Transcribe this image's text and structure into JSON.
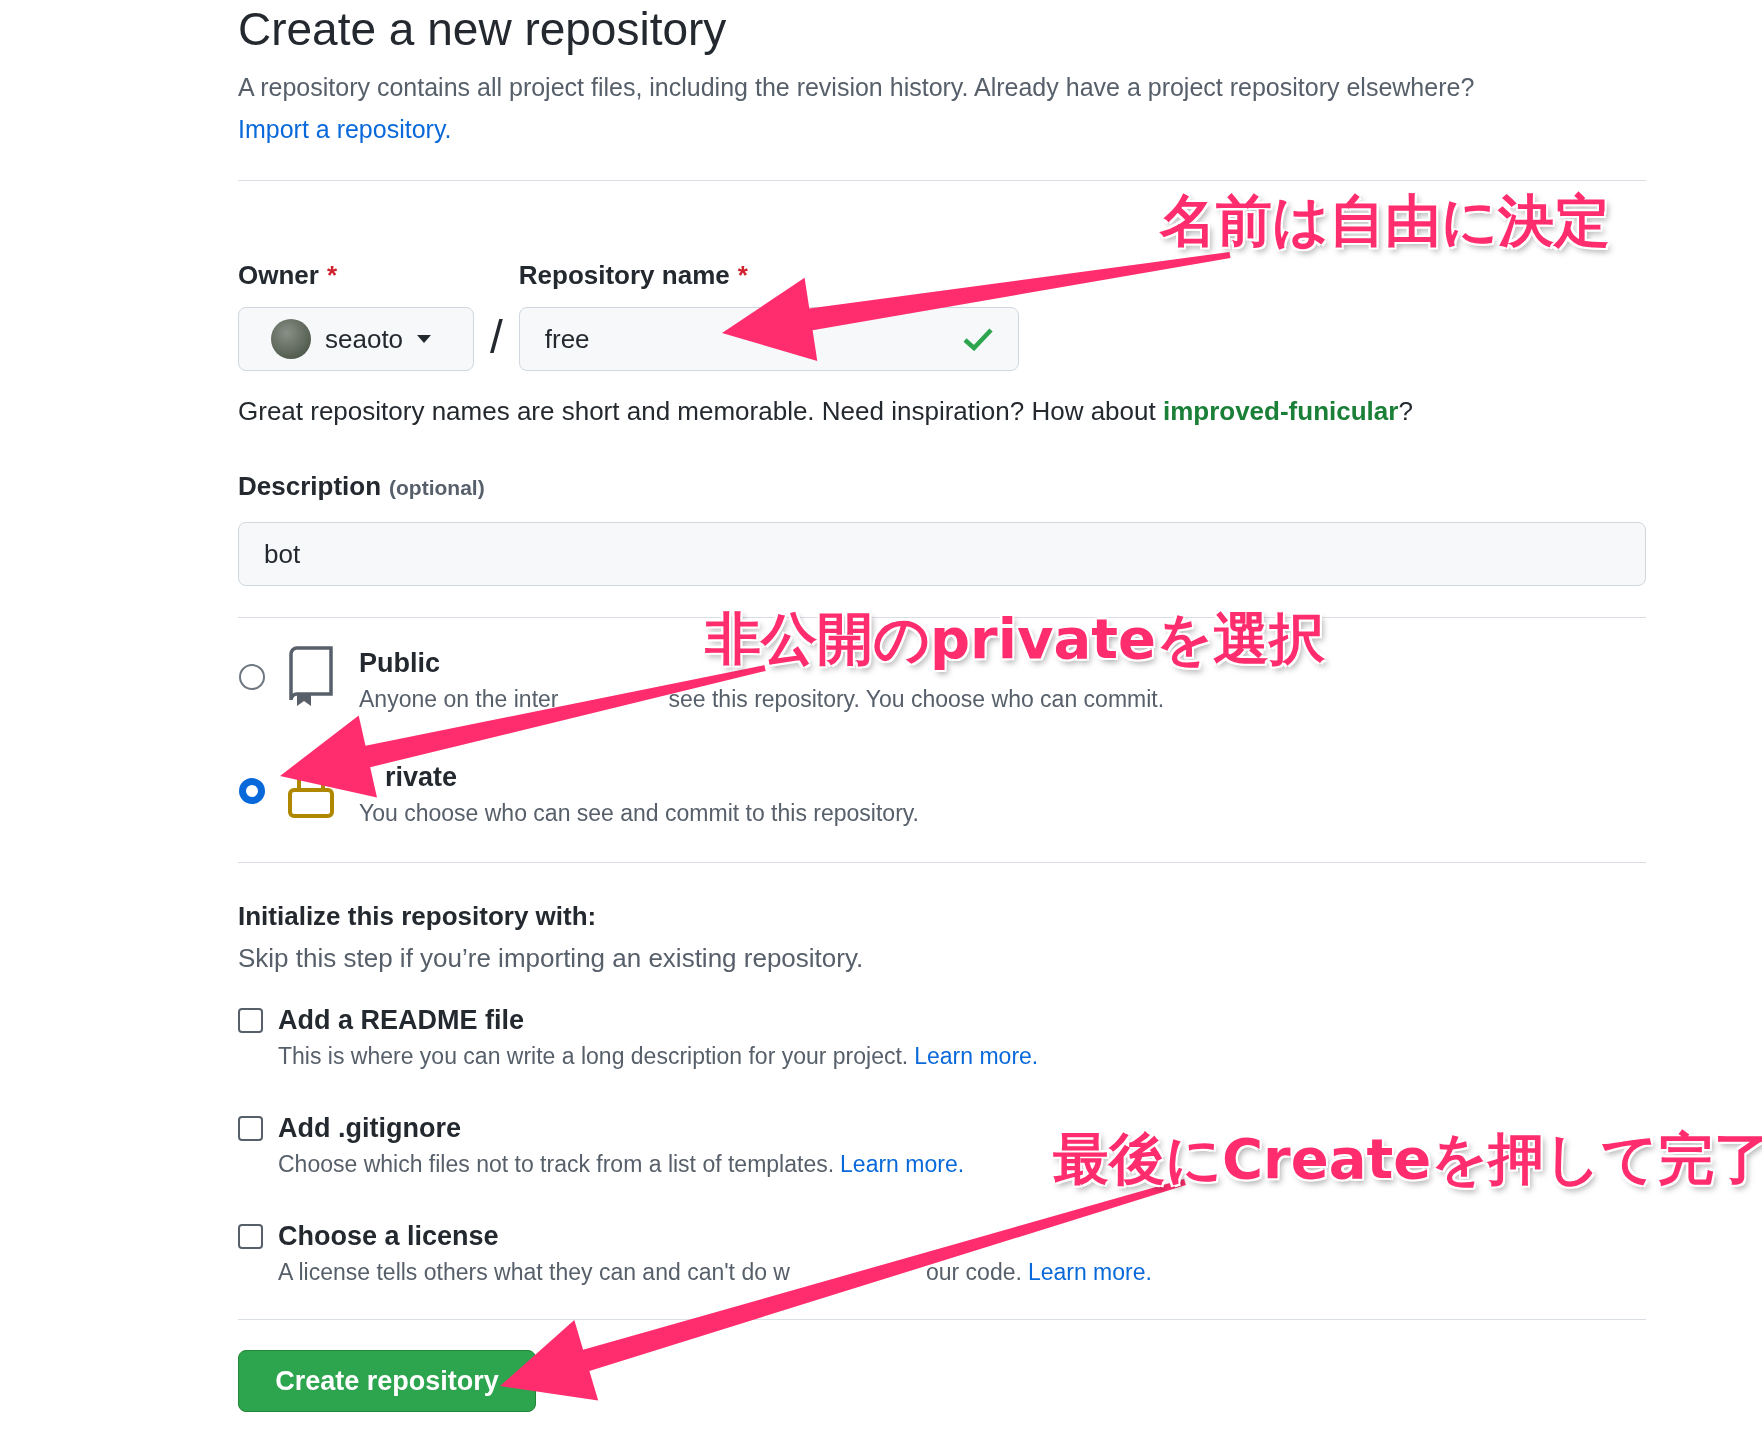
{
  "page": {
    "title": "Create a new repository",
    "intro": "A repository contains all project files, including the revision history. Already have a project repository elsewhere?",
    "import_link": "Import a repository."
  },
  "owner": {
    "label": "Owner",
    "required_mark": "*",
    "value": "seaoto"
  },
  "separator": "/",
  "repository_name": {
    "label": "Repository name",
    "required_mark": "*",
    "value": "free",
    "valid": true
  },
  "name_hint": {
    "text": "Great repository names are short and memorable. Need inspiration? How about",
    "suggestion": "improved-funicular",
    "suffix": "?"
  },
  "description": {
    "label": "Description",
    "optional": "(optional)",
    "value": "bot"
  },
  "visibility": [
    {
      "kind": "public",
      "title": "Public",
      "text": "Anyone on the inter",
      "text_after": "see this repository. You choose who can commit.",
      "selected": false
    },
    {
      "kind": "private",
      "title": "rivate",
      "text": "You choose who can see and commit to this repository.",
      "selected": true
    }
  ],
  "initialize": {
    "title": "Initialize this repository with:",
    "subtitle": "Skip this step if you’re importing an existing repository.",
    "options": [
      {
        "label": "Add a README file",
        "text": "This is where you can write a long description for your project.",
        "link": "Learn more.",
        "checked": false
      },
      {
        "label": "Add .gitignore",
        "text": "Choose which files not to track from a list of templates.",
        "link": "Learn more.",
        "checked": false
      },
      {
        "label": "Choose a license",
        "text": "A license tells others what they can and can't do w",
        "text_after": "our code.",
        "link": "Learn more.",
        "checked": false
      }
    ]
  },
  "create_button": "Create repository",
  "annotations": [
    {
      "text": "名前は自由に決定"
    },
    {
      "text": "非公開のprivateを選択"
    },
    {
      "text": "最後にCreateを押して完了"
    }
  ]
}
